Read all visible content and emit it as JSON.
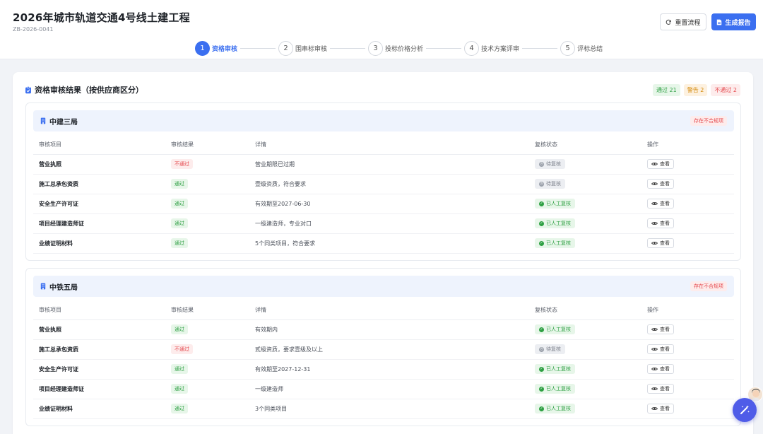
{
  "header": {
    "title": "2026年城市轨道交通4号线土建工程",
    "code": "ZB-2026-0041",
    "reset_label": "重置流程",
    "report_label": "生成报告"
  },
  "steps": [
    {
      "num": "1",
      "label": "资格审核"
    },
    {
      "num": "2",
      "label": "围串标审核"
    },
    {
      "num": "3",
      "label": "投标价格分析"
    },
    {
      "num": "4",
      "label": "技术方案评审"
    },
    {
      "num": "5",
      "label": "评标总结"
    }
  ],
  "section": {
    "title": "资格审核结果（按供应商区分）",
    "badge_pass": "通过 21",
    "badge_warn": "警告 2",
    "badge_fail": "不通过 2"
  },
  "columns": {
    "item": "审核项目",
    "result": "审核结果",
    "detail": "详情",
    "status": "复核状态",
    "action": "操作"
  },
  "suppliers": [
    {
      "name": "中建三局",
      "tag": "存在不合规项",
      "rows": [
        {
          "item": "营业执照",
          "result": "不通过",
          "detail": "营业期限已过期",
          "status": "待复核",
          "action": "查看"
        },
        {
          "item": "施工总承包资质",
          "result": "通过",
          "detail": "壹级资质，符合要求",
          "status": "待复核",
          "action": "查看"
        },
        {
          "item": "安全生产许可证",
          "result": "通过",
          "detail": "有效期至2027-06-30",
          "status": "已人工复核",
          "action": "查看"
        },
        {
          "item": "项目经理建造师证",
          "result": "通过",
          "detail": "一级建造师，专业对口",
          "status": "已人工复核",
          "action": "查看"
        },
        {
          "item": "业绩证明材料",
          "result": "通过",
          "detail": "5个同类项目，符合要求",
          "status": "已人工复核",
          "action": "查看"
        }
      ]
    },
    {
      "name": "中铁五局",
      "tag": "存在不合规项",
      "rows": [
        {
          "item": "营业执照",
          "result": "通过",
          "detail": "有效期内",
          "status": "已人工复核",
          "action": "查看"
        },
        {
          "item": "施工总承包资质",
          "result": "不通过",
          "detail": "贰级资质，要求壹级及以上",
          "status": "待复核",
          "action": "查看"
        },
        {
          "item": "安全生产许可证",
          "result": "通过",
          "detail": "有效期至2027-12-31",
          "status": "已人工复核",
          "action": "查看"
        },
        {
          "item": "项目经理建造师证",
          "result": "通过",
          "detail": "一级建造师",
          "status": "已人工复核",
          "action": "查看"
        },
        {
          "item": "业绩证明材料",
          "result": "通过",
          "detail": "3个同类项目",
          "status": "已人工复核",
          "action": "查看"
        }
      ]
    }
  ],
  "colors": {
    "accent": "#3b6ff0",
    "pass": "#2ea043",
    "fail": "#e5484d",
    "warn": "#d48806"
  },
  "icons": {
    "reset": "refresh-icon",
    "report": "document-icon",
    "section": "clipboard-check-icon",
    "supplier": "building-icon",
    "view": "eye-icon",
    "fab": "magic-wand-icon"
  }
}
